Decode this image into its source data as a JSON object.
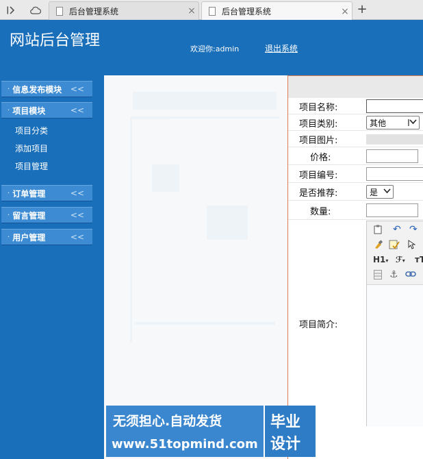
{
  "browser": {
    "tabs": [
      {
        "title": "后台管理系统"
      },
      {
        "title": "后台管理系统"
      }
    ],
    "close_glyph": "×",
    "new_tab_glyph": "+",
    "icons": [
      "sidebar-toggle-icon",
      "cloud-icon",
      "document-icon",
      "close-icon",
      "plus-icon"
    ]
  },
  "header": {
    "title": "网站后台管理",
    "welcome": "欢迎你:admin",
    "logout": "退出系统"
  },
  "sidebar": {
    "sections": [
      {
        "label": "信息发布模块"
      },
      {
        "label": "项目模块",
        "items": [
          "项目分类",
          "添加项目",
          "项目管理"
        ]
      },
      {
        "label": "订单管理"
      },
      {
        "label": "留言管理"
      },
      {
        "label": "用户管理"
      }
    ],
    "bullet": "·",
    "chevron": "<<"
  },
  "form": {
    "fields": {
      "name": {
        "label": "项目名称:",
        "value": ""
      },
      "category": {
        "label": "项目类别:",
        "value": "其他"
      },
      "image": {
        "label": "项目图片:"
      },
      "price": {
        "label": "价格:",
        "value": ""
      },
      "code": {
        "label": "项目编号:",
        "value": ""
      },
      "recommend": {
        "label": "是否推荐:",
        "value": "是"
      },
      "quantity": {
        "label": "数量:",
        "value": ""
      },
      "intro": {
        "label": "项目简介:"
      }
    }
  },
  "editor": {
    "toolbar_icons": [
      "paste-icon",
      "undo-icon",
      "redo-icon",
      "clear-format-icon",
      "spellcheck-icon",
      "select-icon",
      "heading-icon",
      "font-family-icon",
      "font-size-icon",
      "table-icon",
      "anchor-icon",
      "link-icon"
    ],
    "heading_label": "H1",
    "font_label": "ℱ",
    "size_label": "тT"
  },
  "watermark": {
    "line1": "无须担心.自动发货",
    "line2": "www.51topmind.com",
    "badge_line1": "毕业",
    "badge_line2": "设计"
  },
  "colors": {
    "header": "#1a6fbb",
    "sidebar": "#1a6fbb",
    "menu_head": "#3d8bd2",
    "panel_border": "#e07a4f"
  }
}
